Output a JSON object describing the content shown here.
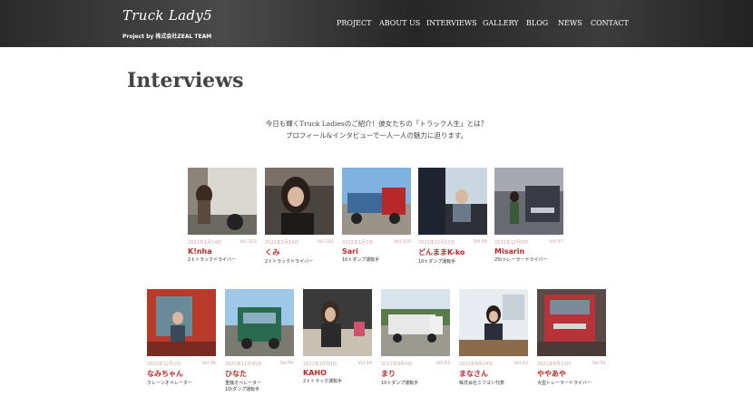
{
  "site": {
    "logo": "Truck Lady5",
    "subtitle": "Project by 株式会社ZEAL TEAM"
  },
  "nav": [
    "PROJECT",
    "ABOUT US",
    "INTERVIEWS",
    "GALLERY",
    "BLOG",
    "NEWS",
    "CONTACT"
  ],
  "page": {
    "title": "Interviews",
    "intro_line1": "今日も輝くTruck Ladiesのご紹介！彼女たちの「トラック人生」とは？",
    "intro_line2": "プロフィール&インタビューで一人一人の魅力に迫ります。"
  },
  "interviews": [
    {
      "date": "2022年1月14日",
      "vol": "Vol.103",
      "name": "K!nha",
      "job": "2ｔトラックドライバー",
      "photo": "woman-leaning-on-truck"
    },
    {
      "date": "2022年1月14日",
      "vol": "Vol.102",
      "name": "くみ",
      "job": "2ｔトラックドライバー",
      "photo": "woman-selfie-in-cab"
    },
    {
      "date": "2022年1月3日",
      "vol": "Vol.100",
      "name": "Sari",
      "job": "10ｔダンプ運転手",
      "photo": "red-dump-truck"
    },
    {
      "date": "2021年12月13日",
      "vol": "Vol.98",
      "name": "どんままK-ko",
      "job": "10ｔダンプ運転手",
      "photo": "woman-driving-cab"
    },
    {
      "date": "2021年12月9日",
      "vol": "Vol.97",
      "name": "Misarin",
      "job": "25tトレーラードライバー",
      "photo": "woman-with-trailer"
    },
    {
      "date": "2021年12月2日",
      "vol": "Vol.96",
      "name": "なみちゃん",
      "job": "クレーンオペレーター",
      "photo": "woman-in-crane-cab"
    },
    {
      "date": "2021年11月30日",
      "vol": "Vol.95",
      "name": "ひなた",
      "job": "重機オペレーター\n10tダンプ運転手",
      "photo": "green-truck"
    },
    {
      "date": "2021年10月8日",
      "vol": "Vol.94",
      "name": "KAHO",
      "job": "2ｔトラック運転手",
      "photo": "woman-in-truck-seat"
    },
    {
      "date": "2021年9月4日",
      "vol": "Vol.93",
      "name": "まり",
      "job": "10ｔダンプ運転手",
      "photo": "white-dump-truck"
    },
    {
      "date": "2021年8月24日",
      "vol": "Vol.92",
      "name": "まなさん",
      "job": "株式会社ミツヨシ代表",
      "photo": "woman-at-desk"
    },
    {
      "date": "2021年8月13日",
      "vol": "Vol.91",
      "name": "ややあや",
      "job": "大型トレーラードライバー",
      "photo": "red-trailer"
    }
  ],
  "colors": {
    "accent": "#c0262a",
    "header": "#2e2e2e"
  }
}
